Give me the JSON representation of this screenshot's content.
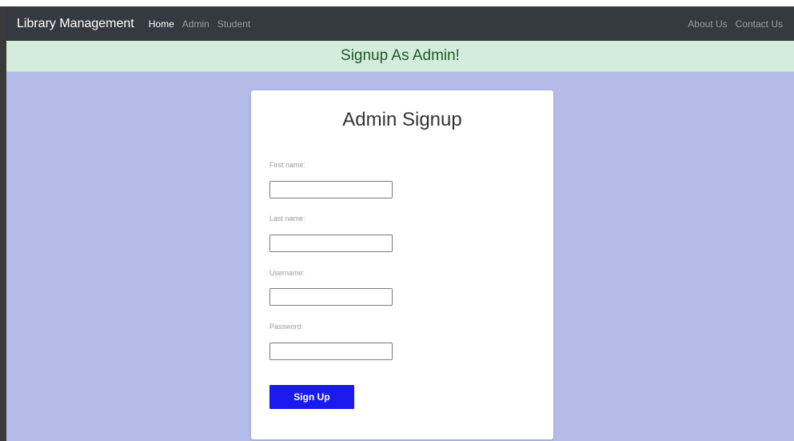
{
  "navbar": {
    "brand": "Library Management",
    "left_links": [
      "Home",
      "Admin",
      "Student"
    ],
    "right_links": [
      "About Us",
      "Contact Us"
    ],
    "active_link": "Home"
  },
  "banner": {
    "text": "Signup As Admin!"
  },
  "form": {
    "title": "Admin Signup",
    "fields": [
      {
        "label": "First name:",
        "value": "",
        "placeholder": ""
      },
      {
        "label": "Last name:",
        "value": "",
        "placeholder": ""
      },
      {
        "label": "Username:",
        "value": "",
        "placeholder": ""
      },
      {
        "label": "Password:",
        "value": "",
        "placeholder": ""
      }
    ],
    "submit_label": "Sign Up"
  },
  "colors": {
    "navbar_bg": "#343a40",
    "banner_bg": "#d4ecdb",
    "banner_text": "#1d5a2a",
    "page_bg": "#b4bbe8",
    "button_bg": "#1a1aee"
  }
}
